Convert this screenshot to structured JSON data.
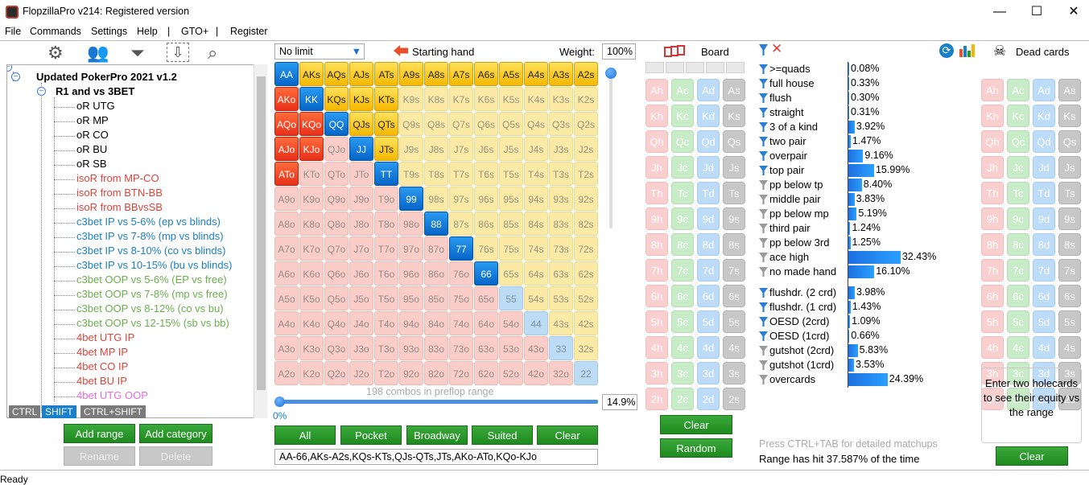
{
  "window": {
    "title": "FlopzillaPro v214: Registered version",
    "minimize": "—",
    "maximize": "☐",
    "close": "✕"
  },
  "menu": [
    "File",
    "Commands",
    "Settings",
    "Help",
    "|",
    "GTO+",
    "|",
    "Register"
  ],
  "toolbar_icons": [
    "gear-icon",
    "users-icon",
    "filter-plus-icon",
    "download-icon",
    "search-icon"
  ],
  "tree": {
    "root": "Updated PokerPro 2021 v1.2",
    "group": "R1 and vs 3BET",
    "items": [
      {
        "label": "oR UTG",
        "color": "#000000"
      },
      {
        "label": "oR MP",
        "color": "#000000"
      },
      {
        "label": "oR CO",
        "color": "#000000"
      },
      {
        "label": "oR BU",
        "color": "#000000"
      },
      {
        "label": "oR SB",
        "color": "#000000"
      },
      {
        "label": "isoR from MP-CO",
        "color": "#e0433a"
      },
      {
        "label": "isoR from BTN-BB",
        "color": "#e0433a"
      },
      {
        "label": "isoR from BBvsSB",
        "color": "#e0433a"
      },
      {
        "label": "c3bet IP vs 5-6% (ep vs blinds)",
        "color": "#1a7fc9"
      },
      {
        "label": "c3bet IP vs 7-8% (mp vs blinds)",
        "color": "#1a7fc9"
      },
      {
        "label": "c3bet IP vs 8-10% (co vs blinds)",
        "color": "#1a7fc9"
      },
      {
        "label": "c3bet IP vs 10-15% (bu vs blinds)",
        "color": "#1a7fc9"
      },
      {
        "label": "c3bet OOP vs 5-6% (EP vs free)",
        "color": "#6ab04c"
      },
      {
        "label": "c3bet OOP vs 7-8% (mp vs free)",
        "color": "#6ab04c"
      },
      {
        "label": "c3bet OOP vs 8-12% (co vs bu)",
        "color": "#6ab04c"
      },
      {
        "label": "c3bet OOP vs 12-15% (sb vs bb)",
        "color": "#6ab04c"
      },
      {
        "label": "4bet UTG IP",
        "color": "#e0433a"
      },
      {
        "label": "4bet MP IP",
        "color": "#e0433a"
      },
      {
        "label": "4bet CO IP",
        "color": "#e0433a"
      },
      {
        "label": "4bet BU IP",
        "color": "#e0433a"
      },
      {
        "label": "4bet UTG OOP",
        "color": "#e86bd8"
      }
    ]
  },
  "modifiers": [
    "CTRL",
    "SHIFT",
    "CTRL+SHIFT"
  ],
  "left_buttons": {
    "add_range": "Add range",
    "add_category": "Add category",
    "rename": "Rename",
    "delete": "Delete"
  },
  "range": {
    "game_type": "No limit",
    "starting_hand_label": "Starting hand",
    "weight_label": "Weight:",
    "weight_value": "100%",
    "combos_text": "198 combos in preflop range",
    "slider_min": "0%",
    "percent": "14.9%",
    "range_text": "AA-66,AKs-A2s,KQs-KTs,QJs-QTs,JTs,AKo-ATo,KQo-KJo",
    "buttons": [
      "All",
      "Pocket",
      "Broadway",
      "Suited",
      "Clear"
    ]
  },
  "grid_ranks": [
    "A",
    "K",
    "Q",
    "J",
    "T",
    "9",
    "8",
    "7",
    "6",
    "5",
    "4",
    "3",
    "2"
  ],
  "grid_selected": [
    "AA",
    "KK",
    "QQ",
    "JJ",
    "TT",
    "99",
    "88",
    "77",
    "66",
    "AKs",
    "AQs",
    "AJs",
    "ATs",
    "A9s",
    "A8s",
    "A7s",
    "A6s",
    "A5s",
    "A4s",
    "A3s",
    "A2s",
    "KQs",
    "KJs",
    "KTs",
    "QJs",
    "QTs",
    "JTs",
    "AKo",
    "AQo",
    "AJo",
    "ATo",
    "KQo",
    "KJo"
  ],
  "board": {
    "label": "Board",
    "ranks": [
      "A",
      "K",
      "Q",
      "J",
      "T",
      "9",
      "8",
      "7",
      "6",
      "5",
      "4",
      "3",
      "2"
    ],
    "suits": [
      "h",
      "c",
      "d",
      "s"
    ],
    "clear": "Clear",
    "random": "Random"
  },
  "stats": {
    "made": [
      {
        "label": ">=quads",
        "pct": "0.08%",
        "value": 0.08,
        "color": "blue"
      },
      {
        "label": "full house",
        "pct": "0.33%",
        "value": 0.33,
        "color": "blue"
      },
      {
        "label": "flush",
        "pct": "0.30%",
        "value": 0.3,
        "color": "blue"
      },
      {
        "label": "straight",
        "pct": "0.31%",
        "value": 0.31,
        "color": "blue"
      },
      {
        "label": "3 of a kind",
        "pct": "3.92%",
        "value": 3.92,
        "color": "blue"
      },
      {
        "label": "two pair",
        "pct": "1.47%",
        "value": 1.47,
        "color": "blue"
      },
      {
        "label": "overpair",
        "pct": "9.16%",
        "value": 9.16,
        "color": "blue"
      },
      {
        "label": "top pair",
        "pct": "15.99%",
        "value": 15.99,
        "color": "blue"
      },
      {
        "label": "pp below tp",
        "pct": "8.40%",
        "value": 8.4,
        "color": "grey"
      },
      {
        "label": "middle pair",
        "pct": "3.83%",
        "value": 3.83,
        "color": "grey"
      },
      {
        "label": "pp below mp",
        "pct": "5.19%",
        "value": 5.19,
        "color": "grey"
      },
      {
        "label": "third pair",
        "pct": "1.24%",
        "value": 1.24,
        "color": "grey"
      },
      {
        "label": "pp below 3rd",
        "pct": "1.25%",
        "value": 1.25,
        "color": "grey"
      },
      {
        "label": "ace high",
        "pct": "32.43%",
        "value": 32.43,
        "color": "grey"
      },
      {
        "label": "no made hand",
        "pct": "16.10%",
        "value": 16.1,
        "color": "grey"
      }
    ],
    "draws": [
      {
        "label": "flushdr. (2 crd)",
        "pct": "3.98%",
        "value": 3.98,
        "color": "blue"
      },
      {
        "label": "flushdr. (1 crd)",
        "pct": "1.43%",
        "value": 1.43,
        "color": "blue"
      },
      {
        "label": "OESD (2crd)",
        "pct": "1.09%",
        "value": 1.09,
        "color": "blue"
      },
      {
        "label": "OESD (1crd)",
        "pct": "0.66%",
        "value": 0.66,
        "color": "blue"
      },
      {
        "label": "gutshot (2crd)",
        "pct": "5.83%",
        "value": 5.83,
        "color": "grey"
      },
      {
        "label": "gutshot (1crd)",
        "pct": "3.53%",
        "value": 3.53,
        "color": "grey"
      },
      {
        "label": "overcards",
        "pct": "24.39%",
        "value": 24.39,
        "color": "grey"
      }
    ],
    "hint": "Press CTRL+TAB for detailed matchups",
    "hit": "Range has hit 37.587% of the time"
  },
  "dead": {
    "label": "Dead cards",
    "equity_hint": "Enter two holecards to see their equity vs the range",
    "clear": "Clear"
  },
  "status": "Ready"
}
